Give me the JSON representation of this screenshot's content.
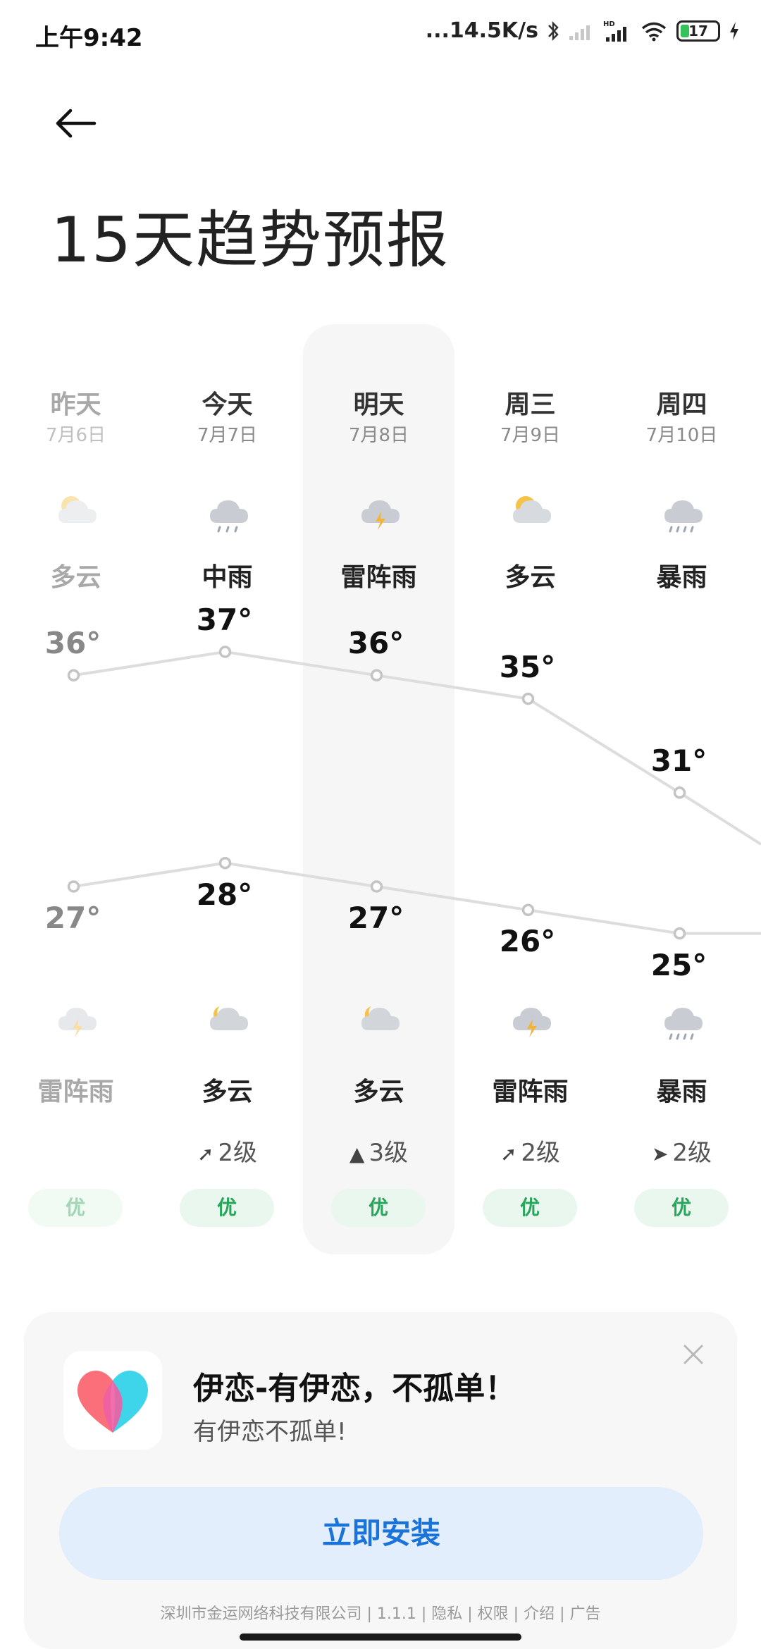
{
  "status": {
    "time": "上午9:42",
    "net_speed": "...14.5K/s",
    "hd": "HD",
    "battery": "17"
  },
  "page": {
    "title": "15天趋势预报"
  },
  "days": [
    {
      "name": "昨天",
      "date": "7月6日",
      "cond_day": "多云",
      "cond_night": "雷阵雨",
      "high": "36°",
      "low": "27°",
      "wind": "",
      "aqi": "优",
      "faded": true,
      "day_icon": "partly-cloudy-icon",
      "night_icon": "thunderstorm-icon"
    },
    {
      "name": "今天",
      "date": "7月7日",
      "cond_day": "中雨",
      "cond_night": "多云",
      "high": "37°",
      "low": "28°",
      "wind": "2级",
      "wind_dir": "northeast",
      "aqi": "优",
      "faded": false,
      "day_icon": "rain-icon",
      "night_icon": "cloudy-night-icon"
    },
    {
      "name": "明天",
      "date": "7月8日",
      "cond_day": "雷阵雨",
      "cond_night": "多云",
      "high": "36°",
      "low": "27°",
      "wind": "3级",
      "wind_dir": "north",
      "aqi": "优",
      "faded": false,
      "day_icon": "thunderstorm-icon",
      "night_icon": "cloudy-night-icon"
    },
    {
      "name": "周三",
      "date": "7月9日",
      "cond_day": "多云",
      "cond_night": "雷阵雨",
      "high": "35°",
      "low": "26°",
      "wind": "2级",
      "wind_dir": "northeast",
      "aqi": "优",
      "faded": false,
      "day_icon": "partly-cloudy-icon",
      "night_icon": "thunderstorm-icon"
    },
    {
      "name": "周四",
      "date": "7月10日",
      "cond_day": "暴雨",
      "cond_night": "暴雨",
      "high": "31°",
      "low": "25°",
      "wind": "2级",
      "wind_dir": "east",
      "aqi": "优",
      "faded": false,
      "day_icon": "heavy-rain-icon",
      "night_icon": "heavy-rain-icon"
    }
  ],
  "chart_data": {
    "type": "line",
    "categories": [
      "昨天",
      "今天",
      "明天",
      "周三",
      "周四"
    ],
    "series": [
      {
        "values": [
          36,
          37,
          36,
          35,
          31
        ]
      },
      {
        "values": [
          27,
          28,
          27,
          26,
          25
        ]
      }
    ],
    "unit": "°"
  },
  "ad": {
    "title": "伊恋-有伊恋，不孤单！",
    "subtitle": "有伊恋不孤单!",
    "button": "立即安装",
    "footer": "深圳市金运网络科技有限公司 | 1.1.1 | 隐私 | 权限 | 介绍 | 广告"
  },
  "colors": {
    "accent_blue": "#1a73d9",
    "aqi_green": "#27a55a",
    "line_gray": "#dddddd"
  }
}
